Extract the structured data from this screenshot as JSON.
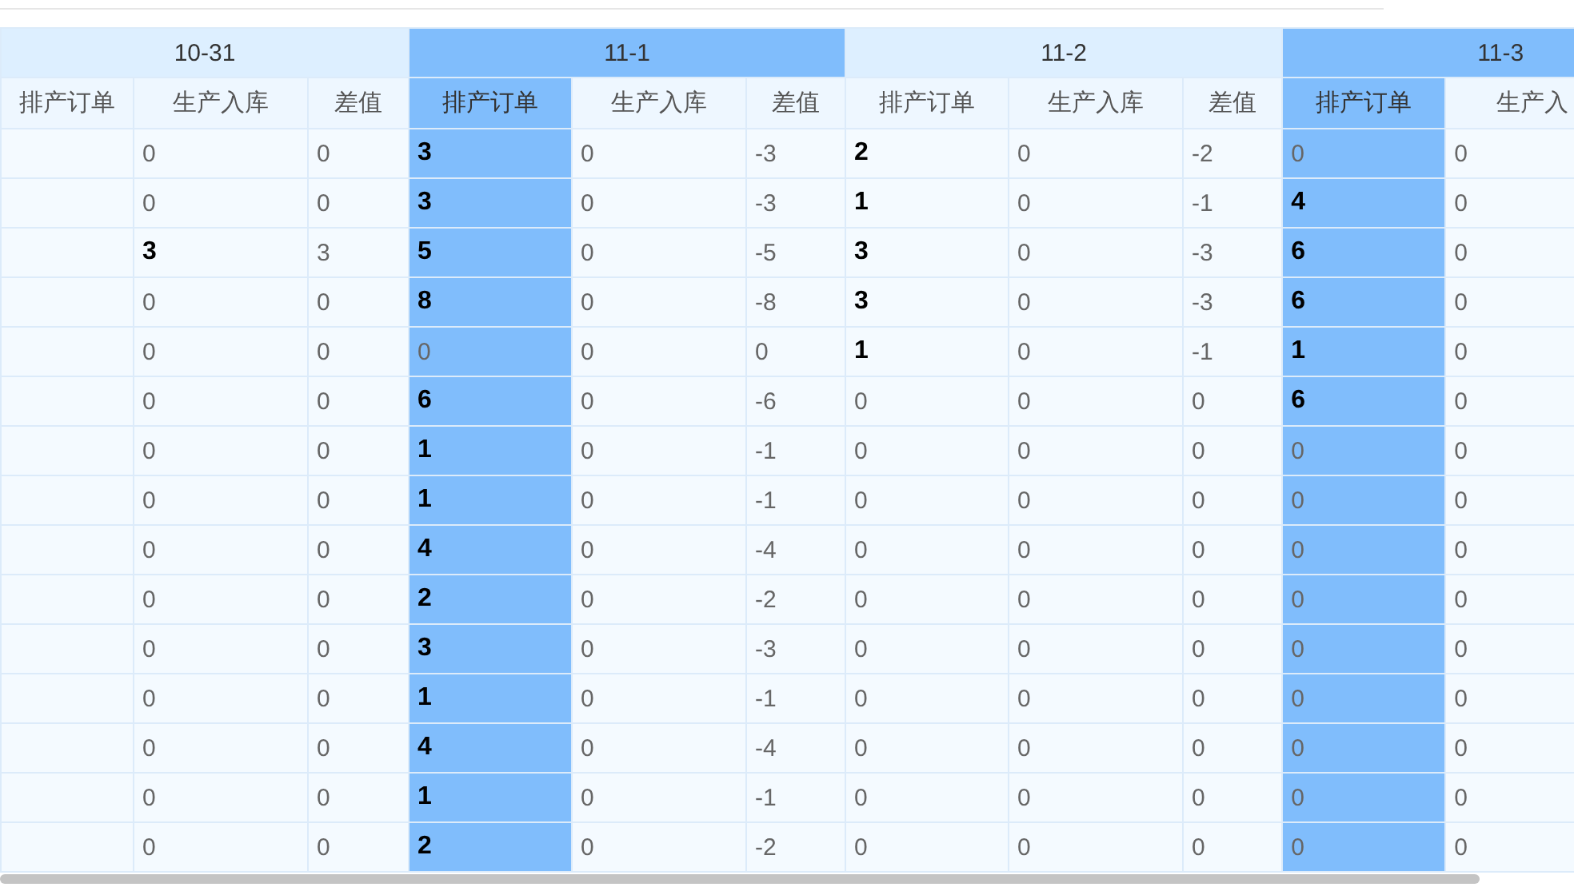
{
  "groups": [
    {
      "date": "10-31",
      "highlighted": false,
      "columns": [
        "排产订单",
        "生产入库",
        "差值"
      ],
      "rows": [
        [
          null,
          {
            "text": "0",
            "bold": false
          },
          {
            "text": "0",
            "bold": false
          }
        ],
        [
          null,
          {
            "text": "0",
            "bold": false
          },
          {
            "text": "0",
            "bold": false
          }
        ],
        [
          null,
          {
            "text": "3",
            "bold": true
          },
          {
            "text": "3",
            "bold": false
          }
        ],
        [
          null,
          {
            "text": "0",
            "bold": false
          },
          {
            "text": "0",
            "bold": false
          }
        ],
        [
          null,
          {
            "text": "0",
            "bold": false
          },
          {
            "text": "0",
            "bold": false
          }
        ],
        [
          null,
          {
            "text": "0",
            "bold": false
          },
          {
            "text": "0",
            "bold": false
          }
        ],
        [
          null,
          {
            "text": "0",
            "bold": false
          },
          {
            "text": "0",
            "bold": false
          }
        ],
        [
          null,
          {
            "text": "0",
            "bold": false
          },
          {
            "text": "0",
            "bold": false
          }
        ],
        [
          null,
          {
            "text": "0",
            "bold": false
          },
          {
            "text": "0",
            "bold": false
          }
        ],
        [
          null,
          {
            "text": "0",
            "bold": false
          },
          {
            "text": "0",
            "bold": false
          }
        ],
        [
          null,
          {
            "text": "0",
            "bold": false
          },
          {
            "text": "0",
            "bold": false
          }
        ],
        [
          null,
          {
            "text": "0",
            "bold": false
          },
          {
            "text": "0",
            "bold": false
          }
        ],
        [
          null,
          {
            "text": "0",
            "bold": false
          },
          {
            "text": "0",
            "bold": false
          }
        ],
        [
          null,
          {
            "text": "0",
            "bold": false
          },
          {
            "text": "0",
            "bold": false
          }
        ],
        [
          null,
          {
            "text": "0",
            "bold": false
          },
          {
            "text": "0",
            "bold": false
          }
        ]
      ]
    },
    {
      "date": "11-1",
      "highlighted": true,
      "columns": [
        "排产订单",
        "生产入库",
        "差值"
      ],
      "rows": [
        [
          {
            "text": "3",
            "bold": true
          },
          {
            "text": "0",
            "bold": false
          },
          {
            "text": "-3",
            "bold": false
          }
        ],
        [
          {
            "text": "3",
            "bold": true
          },
          {
            "text": "0",
            "bold": false
          },
          {
            "text": "-3",
            "bold": false
          }
        ],
        [
          {
            "text": "5",
            "bold": true
          },
          {
            "text": "0",
            "bold": false
          },
          {
            "text": "-5",
            "bold": false
          }
        ],
        [
          {
            "text": "8",
            "bold": true
          },
          {
            "text": "0",
            "bold": false
          },
          {
            "text": "-8",
            "bold": false
          }
        ],
        [
          {
            "text": "0",
            "bold": false
          },
          {
            "text": "0",
            "bold": false
          },
          {
            "text": "0",
            "bold": false
          }
        ],
        [
          {
            "text": "6",
            "bold": true
          },
          {
            "text": "0",
            "bold": false
          },
          {
            "text": "-6",
            "bold": false
          }
        ],
        [
          {
            "text": "1",
            "bold": true
          },
          {
            "text": "0",
            "bold": false
          },
          {
            "text": "-1",
            "bold": false
          }
        ],
        [
          {
            "text": "1",
            "bold": true
          },
          {
            "text": "0",
            "bold": false
          },
          {
            "text": "-1",
            "bold": false
          }
        ],
        [
          {
            "text": "4",
            "bold": true
          },
          {
            "text": "0",
            "bold": false
          },
          {
            "text": "-4",
            "bold": false
          }
        ],
        [
          {
            "text": "2",
            "bold": true
          },
          {
            "text": "0",
            "bold": false
          },
          {
            "text": "-2",
            "bold": false
          }
        ],
        [
          {
            "text": "3",
            "bold": true
          },
          {
            "text": "0",
            "bold": false
          },
          {
            "text": "-3",
            "bold": false
          }
        ],
        [
          {
            "text": "1",
            "bold": true
          },
          {
            "text": "0",
            "bold": false
          },
          {
            "text": "-1",
            "bold": false
          }
        ],
        [
          {
            "text": "4",
            "bold": true
          },
          {
            "text": "0",
            "bold": false
          },
          {
            "text": "-4",
            "bold": false
          }
        ],
        [
          {
            "text": "1",
            "bold": true
          },
          {
            "text": "0",
            "bold": false
          },
          {
            "text": "-1",
            "bold": false
          }
        ],
        [
          {
            "text": "2",
            "bold": true
          },
          {
            "text": "0",
            "bold": false
          },
          {
            "text": "-2",
            "bold": false
          }
        ]
      ]
    },
    {
      "date": "11-2",
      "highlighted": false,
      "columns": [
        "排产订单",
        "生产入库",
        "差值"
      ],
      "rows": [
        [
          {
            "text": "2",
            "bold": true
          },
          {
            "text": "0",
            "bold": false
          },
          {
            "text": "-2",
            "bold": false
          }
        ],
        [
          {
            "text": "1",
            "bold": true
          },
          {
            "text": "0",
            "bold": false
          },
          {
            "text": "-1",
            "bold": false
          }
        ],
        [
          {
            "text": "3",
            "bold": true
          },
          {
            "text": "0",
            "bold": false
          },
          {
            "text": "-3",
            "bold": false
          }
        ],
        [
          {
            "text": "3",
            "bold": true
          },
          {
            "text": "0",
            "bold": false
          },
          {
            "text": "-3",
            "bold": false
          }
        ],
        [
          {
            "text": "1",
            "bold": true
          },
          {
            "text": "0",
            "bold": false
          },
          {
            "text": "-1",
            "bold": false
          }
        ],
        [
          {
            "text": "0",
            "bold": false
          },
          {
            "text": "0",
            "bold": false
          },
          {
            "text": "0",
            "bold": false
          }
        ],
        [
          {
            "text": "0",
            "bold": false
          },
          {
            "text": "0",
            "bold": false
          },
          {
            "text": "0",
            "bold": false
          }
        ],
        [
          {
            "text": "0",
            "bold": false
          },
          {
            "text": "0",
            "bold": false
          },
          {
            "text": "0",
            "bold": false
          }
        ],
        [
          {
            "text": "0",
            "bold": false
          },
          {
            "text": "0",
            "bold": false
          },
          {
            "text": "0",
            "bold": false
          }
        ],
        [
          {
            "text": "0",
            "bold": false
          },
          {
            "text": "0",
            "bold": false
          },
          {
            "text": "0",
            "bold": false
          }
        ],
        [
          {
            "text": "0",
            "bold": false
          },
          {
            "text": "0",
            "bold": false
          },
          {
            "text": "0",
            "bold": false
          }
        ],
        [
          {
            "text": "0",
            "bold": false
          },
          {
            "text": "0",
            "bold": false
          },
          {
            "text": "0",
            "bold": false
          }
        ],
        [
          {
            "text": "0",
            "bold": false
          },
          {
            "text": "0",
            "bold": false
          },
          {
            "text": "0",
            "bold": false
          }
        ],
        [
          {
            "text": "0",
            "bold": false
          },
          {
            "text": "0",
            "bold": false
          },
          {
            "text": "0",
            "bold": false
          }
        ],
        [
          {
            "text": "0",
            "bold": false
          },
          {
            "text": "0",
            "bold": false
          },
          {
            "text": "0",
            "bold": false
          }
        ]
      ]
    },
    {
      "date": "11-3",
      "highlighted": true,
      "columns": [
        "排产订单",
        "生产入"
      ],
      "rows": [
        [
          {
            "text": "0",
            "bold": false
          },
          {
            "text": "0",
            "bold": false
          }
        ],
        [
          {
            "text": "4",
            "bold": true
          },
          {
            "text": "0",
            "bold": false
          }
        ],
        [
          {
            "text": "6",
            "bold": true
          },
          {
            "text": "0",
            "bold": false
          }
        ],
        [
          {
            "text": "6",
            "bold": true
          },
          {
            "text": "0",
            "bold": false
          }
        ],
        [
          {
            "text": "1",
            "bold": true
          },
          {
            "text": "0",
            "bold": false
          }
        ],
        [
          {
            "text": "6",
            "bold": true
          },
          {
            "text": "0",
            "bold": false
          }
        ],
        [
          {
            "text": "0",
            "bold": false
          },
          {
            "text": "0",
            "bold": false
          }
        ],
        [
          {
            "text": "0",
            "bold": false
          },
          {
            "text": "0",
            "bold": false
          }
        ],
        [
          {
            "text": "0",
            "bold": false
          },
          {
            "text": "0",
            "bold": false
          }
        ],
        [
          {
            "text": "0",
            "bold": false
          },
          {
            "text": "0",
            "bold": false
          }
        ],
        [
          {
            "text": "0",
            "bold": false
          },
          {
            "text": "0",
            "bold": false
          }
        ],
        [
          {
            "text": "0",
            "bold": false
          },
          {
            "text": "0",
            "bold": false
          }
        ],
        [
          {
            "text": "0",
            "bold": false
          },
          {
            "text": "0",
            "bold": false
          }
        ],
        [
          {
            "text": "0",
            "bold": false
          },
          {
            "text": "0",
            "bold": false
          }
        ],
        [
          {
            "text": "0",
            "bold": false
          },
          {
            "text": "0",
            "bold": false
          }
        ]
      ]
    }
  ]
}
